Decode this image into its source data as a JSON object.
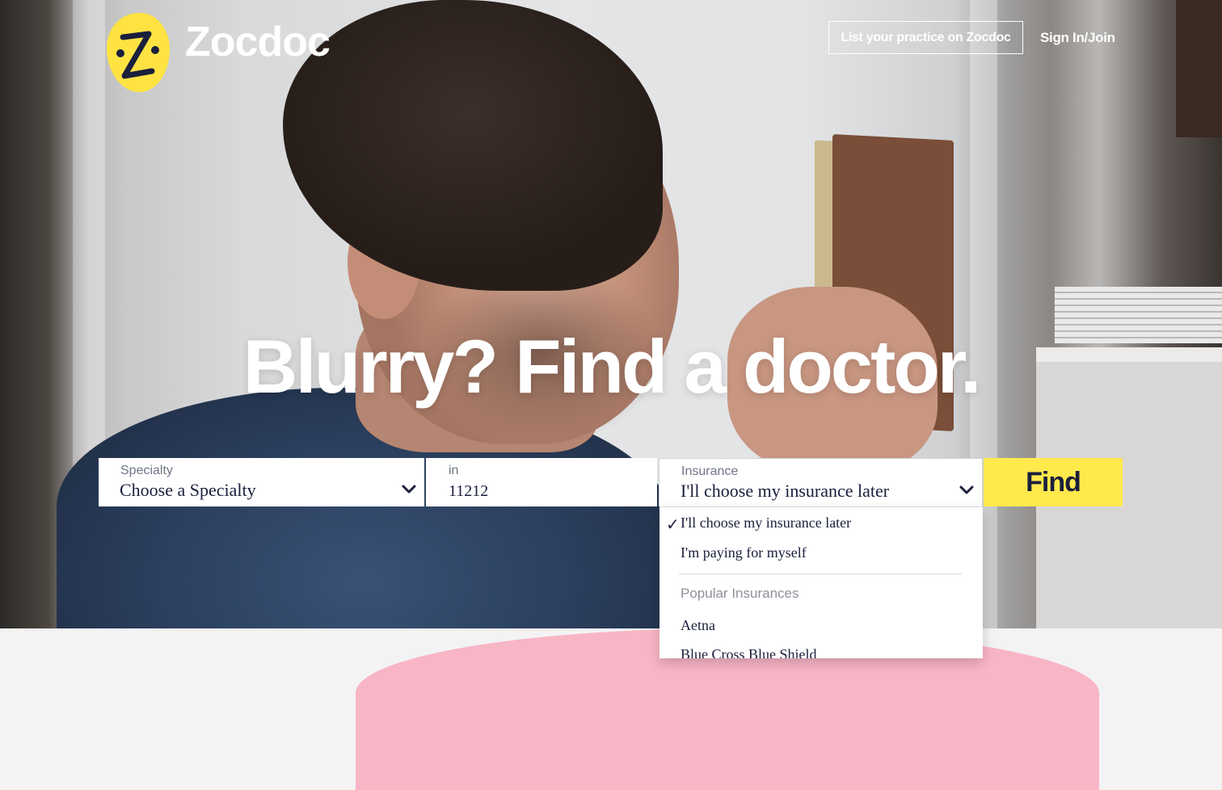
{
  "brand": {
    "name": "Zocdoc",
    "logo_color": "#ffe342"
  },
  "header": {
    "list_practice_label": "List your practice on Zocdoc",
    "sign_in_label": "Sign In/Join"
  },
  "hero": {
    "headline": "Blurry? Find a doctor."
  },
  "search": {
    "specialty": {
      "label": "Specialty",
      "value": "Choose a Specialty",
      "icon": "chevron-down-icon"
    },
    "location": {
      "label": "in",
      "value": "11212"
    },
    "insurance": {
      "label": "Insurance",
      "value": "I'll choose my insurance later",
      "icon": "chevron-down-icon"
    },
    "find_label": "Find"
  },
  "insurance_dropdown": {
    "selected_mark": "✓",
    "options": [
      {
        "label": "I'll choose my insurance later",
        "selected": true
      },
      {
        "label": "I'm paying for myself",
        "selected": false
      }
    ],
    "group_header": "Popular Insurances",
    "popular": [
      "Aetna",
      "Blue Cross Blue Shield"
    ]
  },
  "colors": {
    "accent_yellow": "#ffe94d",
    "text_navy": "#1a1f3c",
    "pink": "#f8b5c6"
  }
}
